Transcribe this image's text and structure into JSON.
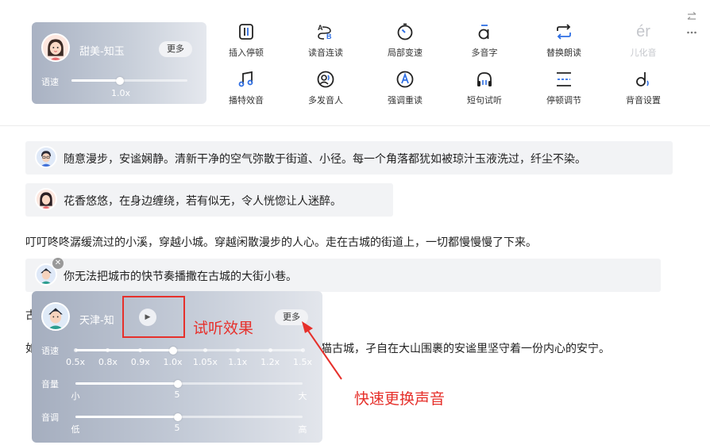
{
  "voice_card": {
    "name": "甜美-知玉",
    "more_label": "更多",
    "speed_label": "语速",
    "speed_value": "1.0x",
    "speed_fraction": 0.42
  },
  "tools": [
    {
      "label": "插入停顿",
      "icon": "pause-insert-icon",
      "disabled": false
    },
    {
      "label": "读音连读",
      "icon": "liaison-icon",
      "disabled": false
    },
    {
      "label": "局部变速",
      "icon": "speed-dial-icon",
      "disabled": false
    },
    {
      "label": "多音字",
      "icon": "polyphone-icon",
      "disabled": false
    },
    {
      "label": "替换朗读",
      "icon": "replace-icon",
      "disabled": false
    },
    {
      "label": "儿化音",
      "icon": "erhua-icon",
      "glyph": "ér",
      "disabled": true
    },
    {
      "label": "播特效音",
      "icon": "music-note-icon",
      "disabled": false
    },
    {
      "label": "多发音人",
      "icon": "multi-speaker-icon",
      "disabled": false
    },
    {
      "label": "强调重读",
      "icon": "emphasis-icon",
      "disabled": false
    },
    {
      "label": "短句试听",
      "icon": "headphone-icon",
      "disabled": false
    },
    {
      "label": "停顿调节",
      "icon": "pause-adjust-icon",
      "disabled": false
    },
    {
      "label": "背音设置",
      "icon": "background-music-icon",
      "disabled": false
    }
  ],
  "content": {
    "s1": "随意漫步，安谧娴静。清新干净的空气弥散于街道、小径。每一个角落都犹如被琼汁玉液洗过，纤尘不染。",
    "s2": "花香悠悠，在身边缠绕，若有似无，令人恍惚让人迷醉。",
    "p1": "叮叮咚咚潺缓流过的小溪，穿越小城。穿越闲散漫步的人心。走在古城的街道上，一切都慢慢慢了下来。",
    "s3": "你无法把城市的快节奏播撒在古城的大街小巷。",
    "p2_start": "古",
    "p3_start": "如",
    "p3_end": "猫古城，孑自在大山围裹的安谧里坚守着一份内心的安宁。",
    "close_glyph": "✕"
  },
  "panel": {
    "name": "天津-知",
    "more_label": "更多",
    "play_glyph": "▶",
    "speed": {
      "label": "语速",
      "fraction": 0.43,
      "ticks": [
        "0.5x",
        "0.8x",
        "0.9x",
        "1.0x",
        "1.05x",
        "1.1x",
        "1.2x",
        "1.5x"
      ]
    },
    "volume": {
      "label": "音量",
      "fraction": 0.45,
      "min": "小",
      "mid": "5",
      "max": "大"
    },
    "pitch": {
      "label": "音调",
      "fraction": 0.45,
      "min": "低",
      "mid": "5",
      "max": "高"
    }
  },
  "annotations": {
    "audition": "试听效果",
    "quick_change": "快速更换声音",
    "color": "#e6302b"
  },
  "corner_icons": [
    "swap-icon",
    "more-dots-icon"
  ]
}
